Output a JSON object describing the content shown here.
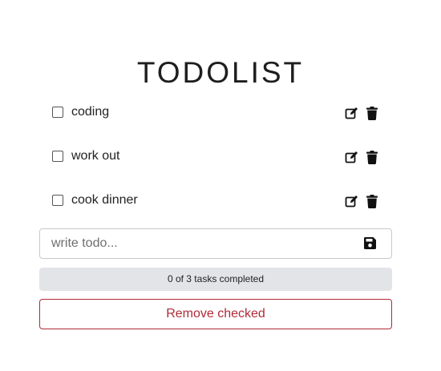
{
  "app": {
    "title": "TODOLIST"
  },
  "todos": [
    {
      "text": "coding",
      "checked": false
    },
    {
      "text": "work out",
      "checked": false
    },
    {
      "text": "cook dinner",
      "checked": false
    }
  ],
  "icons": {
    "edit": "edit-icon",
    "delete": "trash-icon",
    "save": "floppy-disk-icon"
  },
  "input": {
    "value": "",
    "placeholder": "write todo..."
  },
  "status": {
    "text": "0 of 3 tasks completed",
    "completed": 0,
    "total": 3
  },
  "actions": {
    "remove_checked_label": "Remove checked"
  },
  "colors": {
    "danger": "#b02a37",
    "status_bg": "#e3e4e8",
    "border": "#c8c8c8"
  }
}
